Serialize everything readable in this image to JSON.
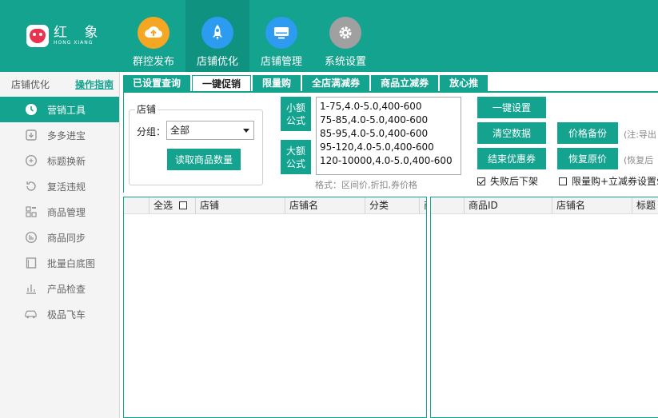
{
  "brand": {
    "name_cn": "红 象",
    "name_en": "HONG XIANG"
  },
  "topnav": [
    {
      "label": "群控发布",
      "icon": "cloud-upload-icon",
      "color": "#f5a623"
    },
    {
      "label": "店铺优化",
      "icon": "rocket-icon",
      "color": "#2c9bf0",
      "active": true
    },
    {
      "label": "店铺管理",
      "icon": "monitor-icon",
      "color": "#2c9bf0"
    },
    {
      "label": "系统设置",
      "icon": "gear-icon",
      "color": "#a0a0a0"
    }
  ],
  "sidebar": {
    "title": "店铺优化",
    "guide": "操作指南",
    "items": [
      {
        "label": "营销工具",
        "icon": "clock-icon",
        "active": true
      },
      {
        "label": "多多进宝",
        "icon": "download-box-icon"
      },
      {
        "label": "标题换新",
        "icon": "tag-icon"
      },
      {
        "label": "复活违规",
        "icon": "revive-icon"
      },
      {
        "label": "商品管理",
        "icon": "grid-icon"
      },
      {
        "label": "商品同步",
        "icon": "sync-icon"
      },
      {
        "label": "批量白底图",
        "icon": "image-icon"
      },
      {
        "label": "产品检查",
        "icon": "check-list-icon"
      },
      {
        "label": "极品飞车",
        "icon": "car-icon"
      }
    ]
  },
  "tabs": [
    {
      "label": "已设置查询"
    },
    {
      "label": "一键促销",
      "active": true
    },
    {
      "label": "限量购"
    },
    {
      "label": "全店满减券"
    },
    {
      "label": "商品立减券"
    },
    {
      "label": "放心推"
    }
  ],
  "shop_group": {
    "legend": "店铺",
    "group_label": "分组：",
    "group_value": "全部",
    "read_button": "读取商品数量"
  },
  "formula": {
    "small_button": "小额\n公式",
    "large_button": "大额\n公式",
    "lines": [
      "1-75,4.0-5.0,400-600",
      "75-85,4.0-5.0,400-600",
      "85-95,4.0-5.0,400-600",
      "95-120,4.0-5.0,400-600",
      "120-10000,4.0-5.0,400-600"
    ],
    "hint": "格式：区间价,折扣,券价格"
  },
  "actions": {
    "one_click": "一键设置",
    "clear": "清空数据",
    "end_coupon": "结束优惠券",
    "price_backup": "价格备份",
    "restore_price": "恢复原价",
    "note_backup": "(注:导出",
    "note_restore": "(恢复后",
    "fail_offshelf": "失败后下架",
    "limit_buy": "限量购+立减券设置$"
  },
  "left_table": {
    "headers": [
      "全选",
      "店铺",
      "店铺名",
      "分类",
      "商"
    ]
  },
  "right_table": {
    "headers": [
      "商品ID",
      "店铺名",
      "标题"
    ]
  }
}
